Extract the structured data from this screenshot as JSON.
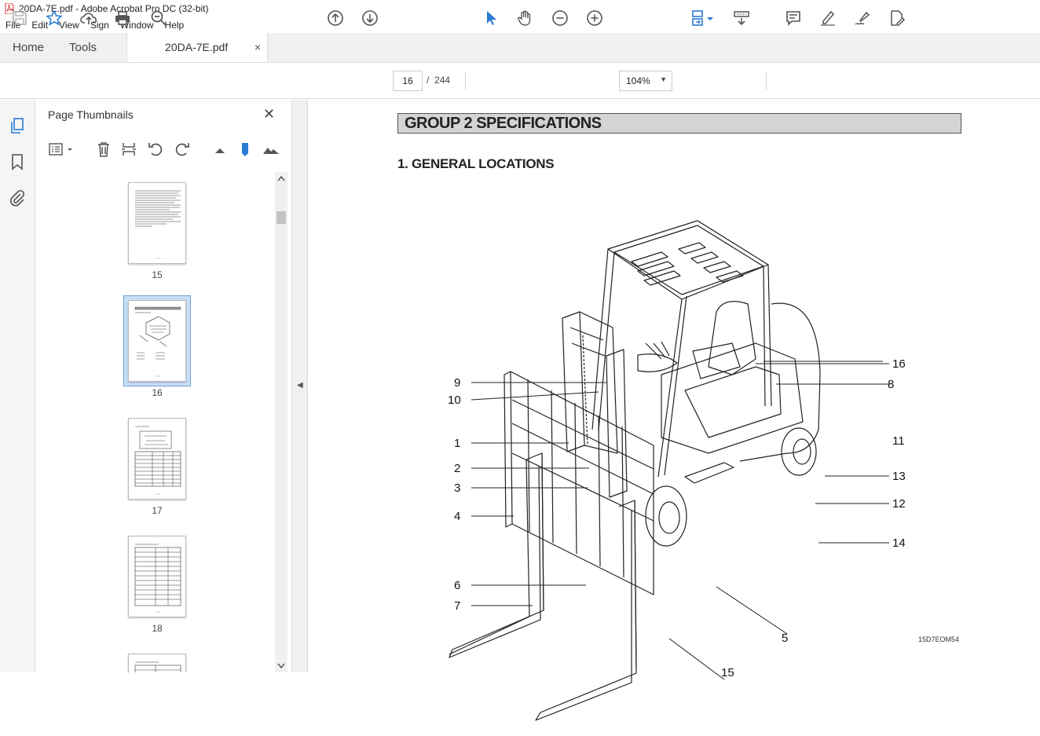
{
  "window": {
    "title": "20DA-7E.pdf - Adobe Acrobat Pro DC (32-bit)"
  },
  "menu": [
    "File",
    "Edit",
    "View",
    "Sign",
    "Window",
    "Help"
  ],
  "tabs": {
    "home": "Home",
    "tools": "Tools",
    "document": "20DA-7E.pdf",
    "close": "×"
  },
  "toolbar": {
    "current_page": "16",
    "page_separator": "/",
    "total_pages": "244",
    "zoom": "104%"
  },
  "panel": {
    "title": "Page Thumbnails",
    "close": "✕",
    "thumbnails": [
      {
        "label": "15",
        "selected": false
      },
      {
        "label": "16",
        "selected": true
      },
      {
        "label": "17",
        "selected": false
      },
      {
        "label": "18",
        "selected": false
      }
    ]
  },
  "document": {
    "group_title": "GROUP 2  SPECIFICATIONS",
    "section_title": "1. GENERAL LOCATIONS",
    "callouts": [
      "1",
      "2",
      "3",
      "4",
      "5",
      "6",
      "7",
      "8",
      "9",
      "10",
      "11",
      "12",
      "13",
      "14",
      "15",
      "16"
    ],
    "figure_code": "15D7EOM54"
  },
  "colors": {
    "accent": "#2a7bd4",
    "title_bar_fill": "#d4d4d4",
    "pdf_red": "#d0312d"
  }
}
